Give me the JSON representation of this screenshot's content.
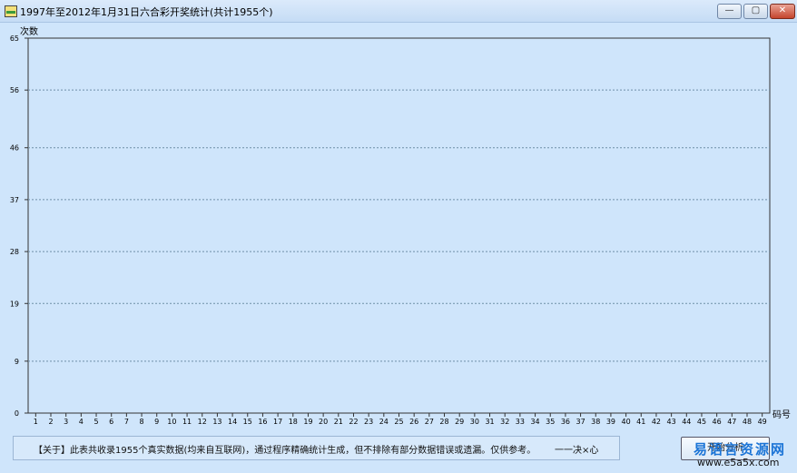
{
  "window": {
    "title": "1997年至2012年1月31日六合彩开奖统计(共计1955个)",
    "controls": {
      "minimize": "—",
      "maximize": "▢",
      "close": "✕"
    }
  },
  "chart_data": {
    "type": "bar",
    "ylabel": "次数",
    "xlabel": "码号",
    "ylim": [
      0,
      65
    ],
    "yticks": [
      0,
      9,
      19,
      28,
      37,
      46,
      56,
      65
    ],
    "categories": [
      "1",
      "2",
      "3",
      "4",
      "5",
      "6",
      "7",
      "8",
      "9",
      "10",
      "11",
      "12",
      "13",
      "14",
      "15",
      "16",
      "17",
      "18",
      "19",
      "20",
      "21",
      "22",
      "23",
      "24",
      "25",
      "26",
      "27",
      "28",
      "29",
      "30",
      "31",
      "32",
      "33",
      "34",
      "35",
      "36",
      "37",
      "38",
      "39",
      "40",
      "41",
      "42",
      "43",
      "44",
      "45",
      "46",
      "47",
      "48",
      "49"
    ],
    "values": [],
    "grid": "horizontal dashed"
  },
  "footer": {
    "text": "【关于】此表共收录1955个真实数据(均来自互联网)，通过程序精确统计生成，但不排除有部分数据错误或遗漏。仅供参考。",
    "signature": "一一决×心"
  },
  "analyze_button": "开始分析",
  "watermark": {
    "line1": "易语言资源网",
    "line2": "www.e5a5x.com"
  },
  "colors": {
    "background": "#cfe5fb",
    "grid": "#6f8fa8",
    "axis": "#333333"
  }
}
